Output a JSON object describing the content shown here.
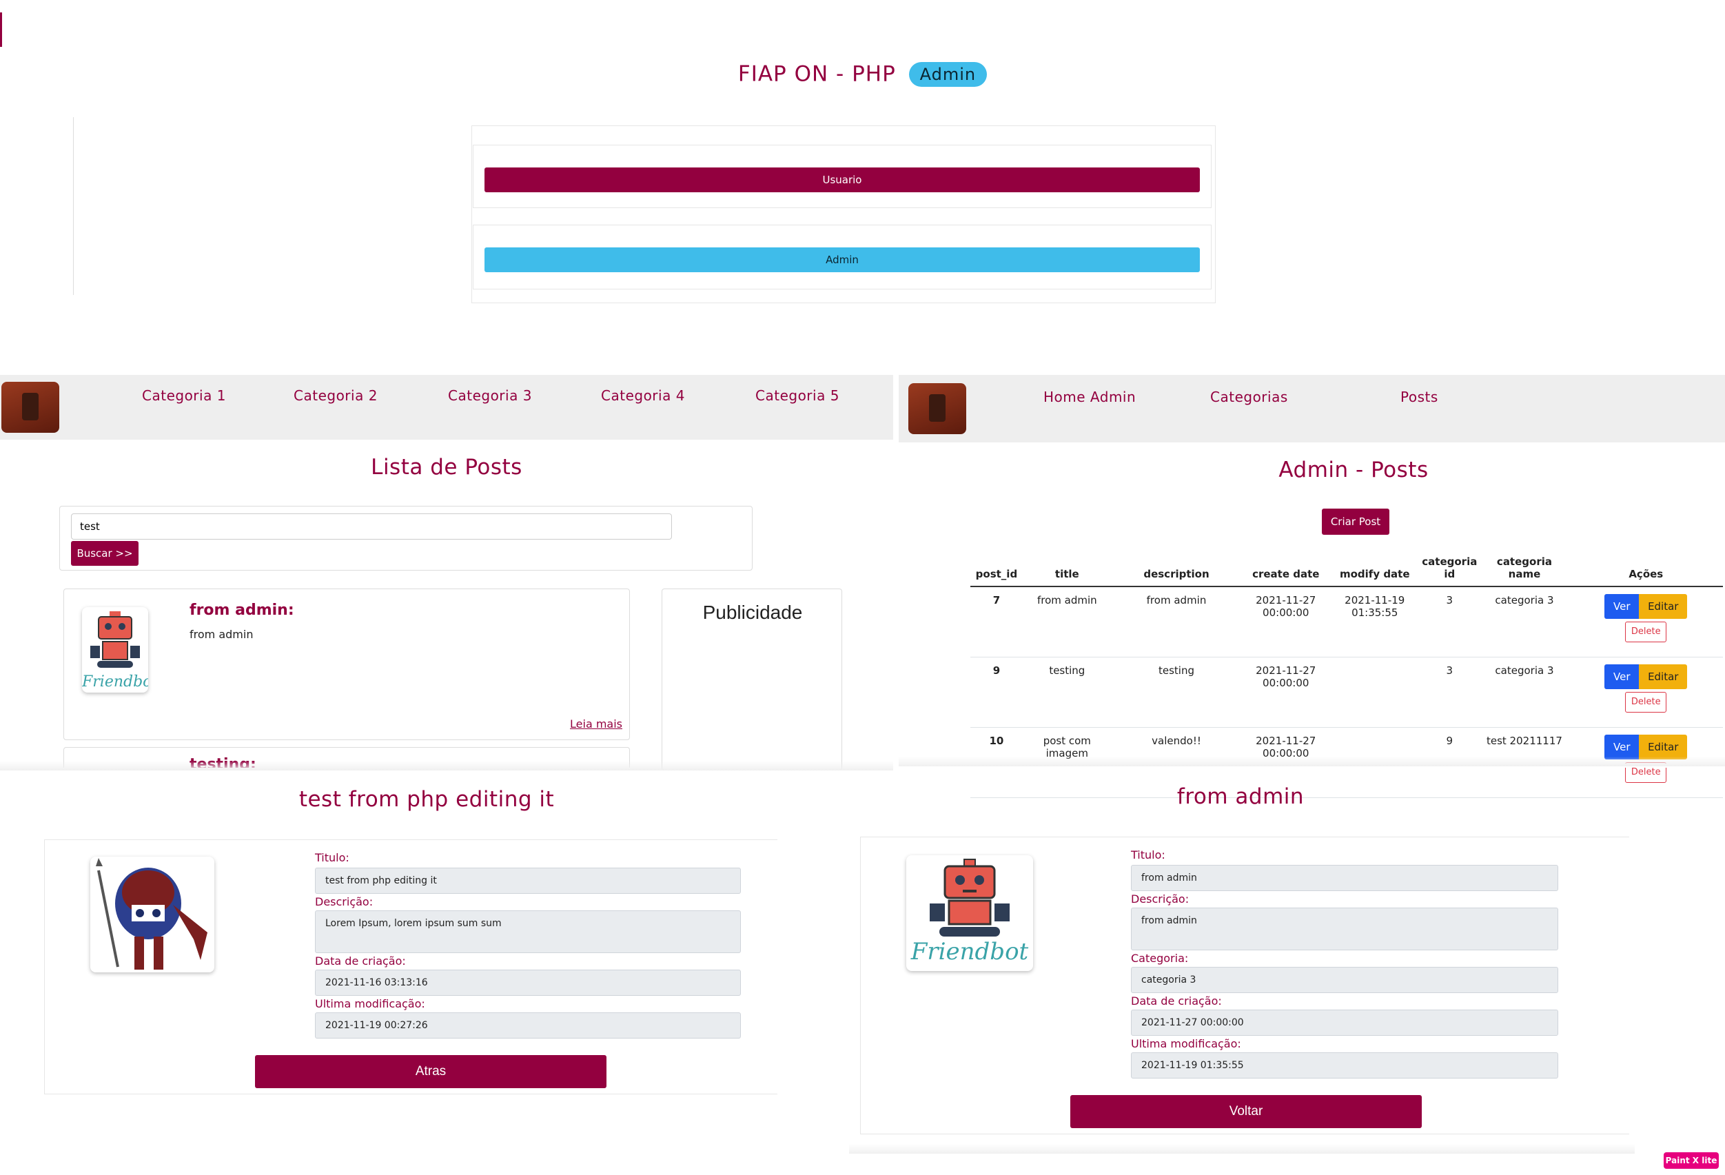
{
  "top": {
    "title": "FIAP ON - PHP",
    "badge": "Admin",
    "buttons": {
      "usuario": "Usuario",
      "admin": "Admin"
    }
  },
  "user_nav": {
    "items": [
      "Categoria 1",
      "Categoria 2",
      "Categoria 3",
      "Categoria 4",
      "Categoria 5"
    ]
  },
  "user_list": {
    "title": "Lista de Posts",
    "search_value": "test",
    "search_button": "Buscar >>",
    "post": {
      "title": "from admin:",
      "text": "from admin",
      "read_more": "Leia mais"
    },
    "post2_title": "testing:",
    "ad_title": "Publicidade"
  },
  "admin_nav": {
    "items": [
      "Home Admin",
      "Categorias",
      "Posts"
    ]
  },
  "admin_posts": {
    "title": "Admin - Posts",
    "create_button": "Criar Post",
    "columns": [
      "post_id",
      "title",
      "description",
      "create date",
      "modify date",
      "categoria id",
      "categoria name",
      "Ações"
    ],
    "rows": [
      {
        "post_id": "7",
        "title": "from admin",
        "description": "from admin",
        "create_date": "2021-11-27 00:00:00",
        "modify_date": "2021-11-19 01:35:55",
        "categoria_id": "3",
        "categoria_name": "categoria 3"
      },
      {
        "post_id": "9",
        "title": "testing",
        "description": "testing",
        "create_date": "2021-11-27 00:00:00",
        "modify_date": "",
        "categoria_id": "3",
        "categoria_name": "categoria 3"
      },
      {
        "post_id": "10",
        "title": "post com imagem",
        "description": "valendo!!",
        "create_date": "2021-11-27 00:00:00",
        "modify_date": "",
        "categoria_id": "9",
        "categoria_name": "test 20211117"
      }
    ],
    "actions": {
      "ver": "Ver",
      "editar": "Editar",
      "delete": "Delete"
    }
  },
  "detail_user": {
    "title": "test from php editing it",
    "labels": {
      "titulo": "Titulo:",
      "descricao": "Descrição:",
      "data_criacao": "Data de criação:",
      "ultima_mod": "Ultima modificação:"
    },
    "values": {
      "titulo": "test from php editing it",
      "descricao": "Lorem Ipsum, lorem ipsum sum sum",
      "data_criacao": "2021-11-16 03:13:16",
      "ultima_mod": "2021-11-19 00:27:26"
    },
    "button": "Atras"
  },
  "detail_admin": {
    "title": "from admin",
    "labels": {
      "titulo": "Titulo:",
      "descricao": "Descrição:",
      "categoria": "Categoria:",
      "data_criacao": "Data de criação:",
      "ultima_mod": "Ultima modificação:"
    },
    "values": {
      "titulo": "from admin",
      "descricao": "from admin",
      "categoria": "categoria 3",
      "data_criacao": "2021-11-27 00:00:00",
      "ultima_mod": "2021-11-19 01:35:55"
    },
    "button": "Voltar"
  },
  "friendbot_text": "Friendbot",
  "watermark": "Paint X lite",
  "colors": {
    "brand": "#93003f",
    "accent": "#3fbcea",
    "nav_bg": "#eeeeee",
    "ver": "#1e5cf0",
    "editar": "#f2b00c",
    "delete": "#dc3545"
  }
}
